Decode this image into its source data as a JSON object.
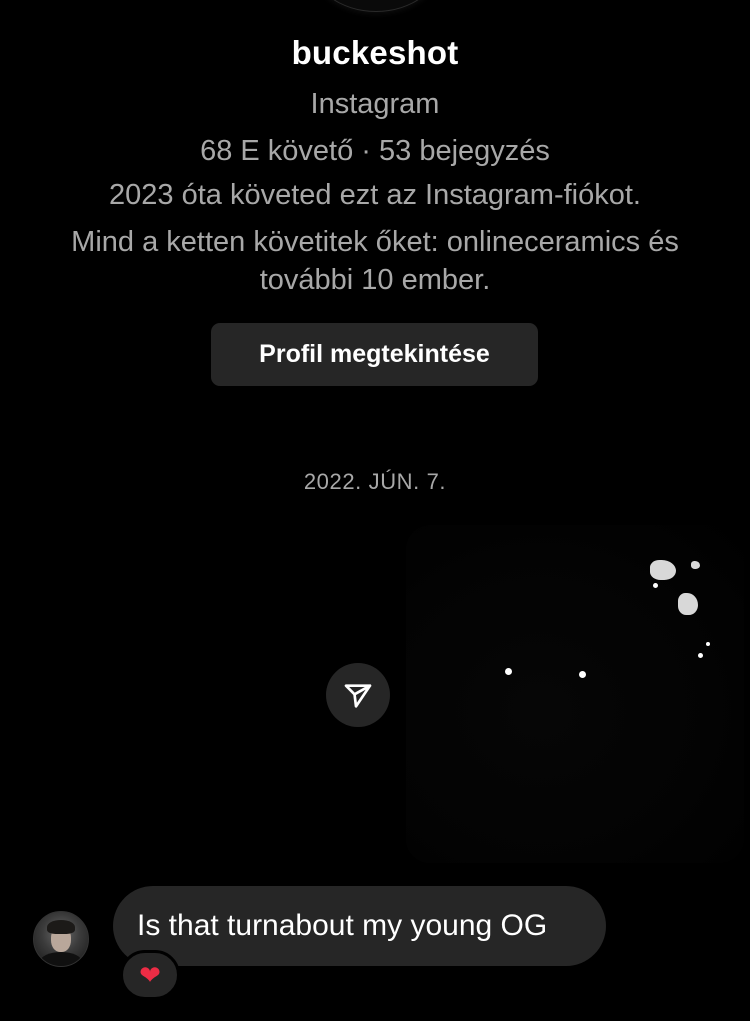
{
  "profile": {
    "username": "buckeshot",
    "source": "Instagram",
    "stats": "68 E követő · 53 bejegyzés",
    "follow_since": "2023 óta követed ezt az Instagram-fiókot.",
    "mutuals_line1": "Mind a ketten követitek őket: onlineceramics és",
    "mutuals_line2": "további 10 ember.",
    "view_profile_label": "Profil megtekintése"
  },
  "thread": {
    "date_divider": "2022. JÚN. 7.",
    "shared_media": {
      "share_icon": "paper-plane-icon"
    },
    "messages": [
      {
        "text": "Is that turnabout my young OG",
        "reaction": "❤",
        "reaction_icon": "heart-icon",
        "avatar_icon": "user-avatar"
      }
    ]
  },
  "colors": {
    "background": "#000000",
    "surface": "#262626",
    "secondary_text": "#a8a8a8",
    "heart": "#ed2c45"
  }
}
